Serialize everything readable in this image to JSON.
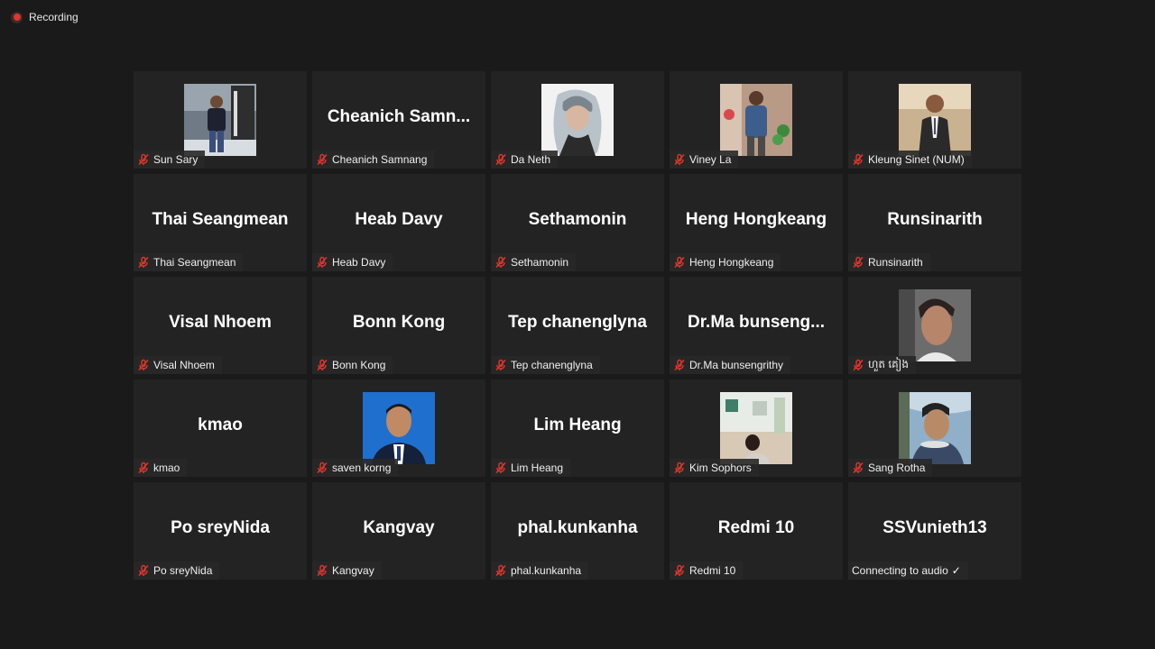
{
  "recording": {
    "label": "Recording"
  },
  "participants": [
    {
      "big": "",
      "label": "Sun Sary",
      "photo": "sun",
      "muted": true
    },
    {
      "big": "Cheanich  Samn...",
      "label": "Cheanich Samnang",
      "muted": true
    },
    {
      "big": "",
      "label": "Da Neth",
      "photo": "da",
      "muted": true
    },
    {
      "big": "",
      "label": "Viney La",
      "photo": "viney",
      "muted": true
    },
    {
      "big": "",
      "label": "Kleung Sinet (NUM)",
      "photo": "kleung",
      "muted": true
    },
    {
      "big": "Thai Seangmean",
      "label": "Thai Seangmean",
      "muted": true
    },
    {
      "big": "Heab Davy",
      "label": "Heab Davy",
      "muted": true
    },
    {
      "big": "Sethamonin",
      "label": "Sethamonin",
      "muted": true
    },
    {
      "big": "Heng Hongkeang",
      "label": "Heng Hongkeang",
      "muted": true
    },
    {
      "big": "Runsinarith",
      "label": "Runsinarith",
      "muted": true
    },
    {
      "big": "Visal Nhoem",
      "label": "Visal Nhoem",
      "muted": true
    },
    {
      "big": "Bonn Kong",
      "label": "Bonn Kong",
      "muted": true
    },
    {
      "big": "Tep chanenglyna",
      "label": "Tep chanenglyna",
      "muted": true
    },
    {
      "big": "Dr.Ma  bunseng...",
      "label": "Dr.Ma bunsengrithy",
      "muted": true
    },
    {
      "big": "",
      "label": "ហួត គៀង",
      "photo": "huot",
      "muted": true
    },
    {
      "big": "kmao",
      "label": "kmao",
      "muted": true
    },
    {
      "big": "",
      "label": "saven korng",
      "photo": "saven",
      "muted": true
    },
    {
      "big": "Lim Heang",
      "label": "Lim Heang",
      "muted": true
    },
    {
      "big": "",
      "label": "Kim Sophors",
      "photo": "kim",
      "muted": true
    },
    {
      "big": "",
      "label": "Sang Rotha",
      "photo": "sang",
      "muted": true
    },
    {
      "big": "Po sreyNida",
      "label": "Po sreyNida",
      "muted": true
    },
    {
      "big": "Kangvay",
      "label": "Kangvay",
      "muted": true
    },
    {
      "big": "phal.kunkanha",
      "label": "phal.kunkanha",
      "muted": true
    },
    {
      "big": "Redmi 10",
      "label": "Redmi 10",
      "muted": true
    },
    {
      "big": "SSVunieth13",
      "label": "Connecting to audio",
      "muted": false,
      "connecting": true
    }
  ],
  "colors": {
    "background": "#1a1a1a",
    "tile": "#232323",
    "mute_red": "#e0362b"
  },
  "icons": {
    "muted": "muted-mic-icon",
    "check": "✓"
  }
}
